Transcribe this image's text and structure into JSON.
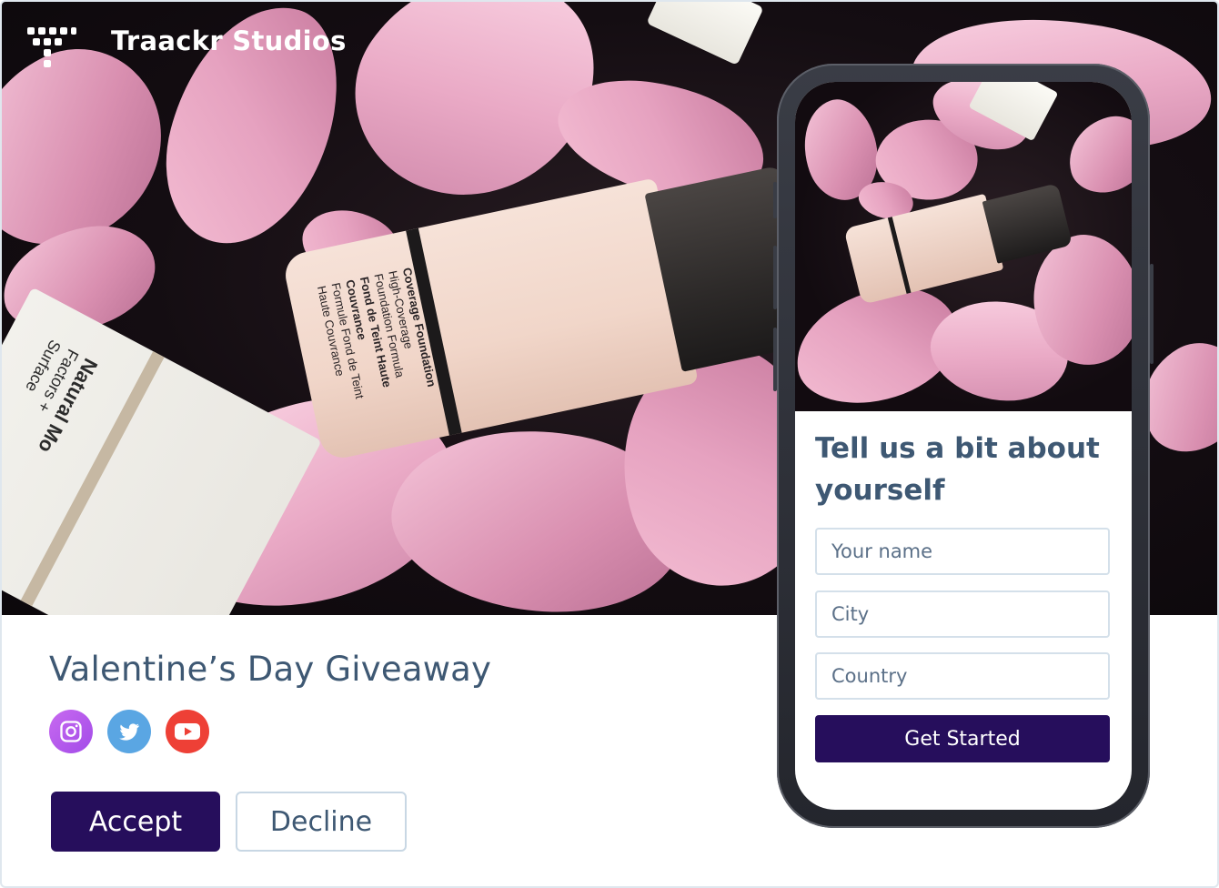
{
  "brand": {
    "name": "Traackr Studios"
  },
  "campaign": {
    "title": "Valentine’s Day Giveaway",
    "social_icons": [
      "instagram-icon",
      "twitter-icon",
      "youtube-icon"
    ],
    "accept_label": "Accept",
    "decline_label": "Decline"
  },
  "product": {
    "bottle_label_title": "Coverage Foundation",
    "bottle_label_line1": "High-Coverage",
    "bottle_label_line2": "Foundation Formula",
    "bottle_label_line3": "Fond de Teint Haute Couvrance",
    "bottle_label_line4": "Formule Fond de Teint",
    "bottle_label_line5": "Haute Couvrance",
    "tube_label_line1": "Natural Mo",
    "tube_label_line2": "Factors +",
    "tube_label_line3": "Surface"
  },
  "phone_form": {
    "title": "Tell us a bit about yourself",
    "name_placeholder": "Your name",
    "city_placeholder": "City",
    "country_placeholder": "Country",
    "submit_label": "Get Started"
  },
  "colors": {
    "primary": "#260e5c",
    "title_text": "#3e5873",
    "instagram": "#a24be8",
    "twitter": "#5aa6e3",
    "youtube": "#ee4036"
  }
}
